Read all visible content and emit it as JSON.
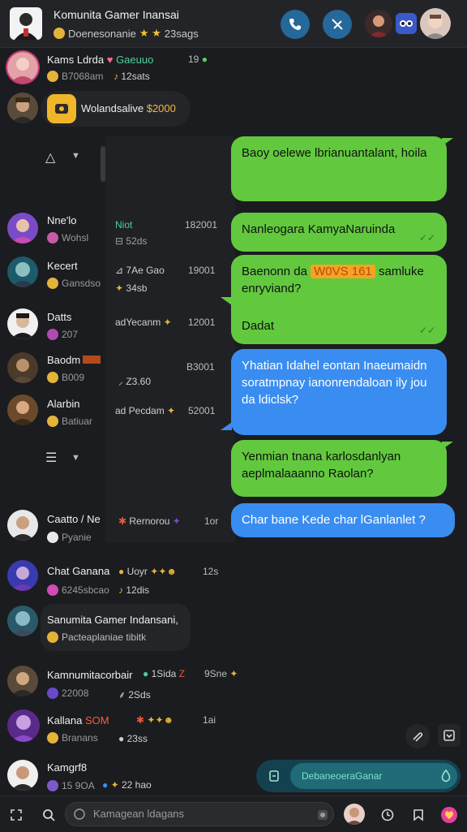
{
  "header": {
    "title": "Komunita Gamer Inansai",
    "subtitle": "Doenesonanie",
    "stars": "★ ★",
    "subtitle_count": "23sags"
  },
  "left_list": [
    {
      "name": "Kams Ldrda",
      "name_accent": "Gaeuuo",
      "sub": "B7068am",
      "sub2": "12sats",
      "time": "19"
    },
    {
      "name": "Nne'lo",
      "sub": "Wohsl"
    },
    {
      "name": "Kecert",
      "sub": "Gansdso"
    },
    {
      "name": "Datts",
      "sub": "207"
    },
    {
      "name": "Baodm",
      "sub": "B009"
    },
    {
      "name": "Alarbin",
      "sub": "Batiuar"
    },
    {
      "name": "Caatto / Ne",
      "sub": "Pyanie"
    },
    {
      "name": "Chat Ganana",
      "sub": "6245sbcao"
    },
    {
      "name": "Sanumita Gamer Indansani,",
      "sub": "Pacteaplaniae tibitk"
    },
    {
      "name": "Kamnumitacorbair",
      "sub": "22008"
    },
    {
      "name": "Kallana",
      "name_accent": "SOM",
      "sub": "Branans"
    },
    {
      "name": "Kamgrf8",
      "sub": "15 9OA"
    }
  ],
  "mid_column": [
    {
      "label": "Niot",
      "time": "182001",
      "sub": "52ds"
    },
    {
      "label": "7Ae Gao",
      "time": "19001",
      "sub": "34sb"
    },
    {
      "label": "adYecanm",
      "time": "12001"
    },
    {
      "label": "Z3.60",
      "time": "B3001"
    },
    {
      "label": "ad Pecdam",
      "time": "52001"
    },
    {
      "label": "Rernorou",
      "time": "1or"
    },
    {
      "label": "Uoyr",
      "sub": "12dis",
      "time": "12s"
    },
    {
      "label": "1Sida",
      "sub": "2Sds",
      "time": "9Sne"
    },
    {
      "label": "23ss",
      "time": "1ai"
    },
    {
      "label": "22 hao"
    }
  ],
  "pinned": {
    "text": "Wolandsalive",
    "value": "$2000"
  },
  "messages": [
    {
      "text": "Baoy oelewe lbrianuantalant, hoila",
      "color": "green"
    },
    {
      "text": "Nanleogara KamyaNaruinda",
      "color": "green",
      "check": "✓✓"
    },
    {
      "text_before": "Baenonn da",
      "highlight": "W0VS 161",
      "text_after": "samluke enryviand?",
      "line2": "Dadat",
      "color": "green",
      "check": "✓✓"
    },
    {
      "text": "Yhatian Idahel eontan Inaeumaidn soratmpnay ianonrendaloan ily jou da ldiclsk?",
      "color": "blue"
    },
    {
      "text": "Yenmian tnana karlosdanlyan aeplmalaaanno Raolan?",
      "color": "green"
    },
    {
      "text": "Char bane Kede char lGanlanlet ?",
      "color": "blue"
    }
  ],
  "compose": {
    "placeholder": "DebaneoeraGanar"
  },
  "search": {
    "placeholder": "Kamagean ldagans"
  },
  "colors": {
    "accent_green": "#62c93e",
    "accent_blue": "#3a8df0",
    "header_button": "#25689a"
  }
}
